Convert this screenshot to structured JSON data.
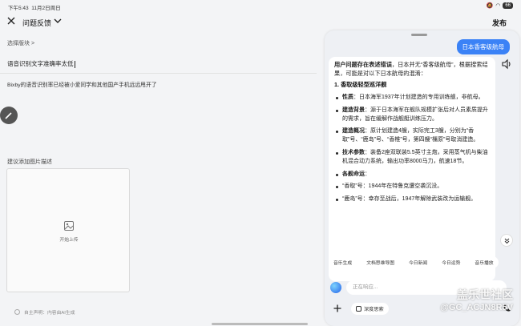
{
  "status": {
    "time": "下午5:43",
    "date": "11月2日周日",
    "battery": "66"
  },
  "header": {
    "title": "问题反馈",
    "publish": "发布"
  },
  "form": {
    "module_select": "选择版块 >",
    "title_value": "语音识别文字准确率太低",
    "description": "Bixby的语音识别率已经被小爱同学和其他国产手机远远甩开了",
    "image_label": "建议添加图片描述",
    "upload_text": "开始上传",
    "ai_disclaimer": "自主声明：内容由AI生成"
  },
  "chat": {
    "user_query": "日本香客级航母",
    "intro_bold": "用户问题存在表述错误",
    "intro_rest": "，日本并无“香客级航母”，根据搜索结果，可能是对以下日本航母的混淆：",
    "section_heading": "1. 香取级轻型巡洋舰",
    "bullets": [
      {
        "label": "性质",
        "text": "：日本海军1937年计划建造的专用训练舰，非航母。"
      },
      {
        "label": "建造背景",
        "text": "：源于日本海军在舰队规模扩张后对人员素质提升的需求，旨在缓解作战舰艇训练压力。"
      },
      {
        "label": "建造概况",
        "text": "：原计划建造4艘，实际完工3艘，分别为“香取”号、“鹿岛”号、“香椎”号，第四艘“橿原”号取消建造。"
      },
      {
        "label": "技术参数",
        "text": "：装备2座双联装5.5英寸主炮，采用蒸气机与柴油机混合动力系统，输出功率8000马力，航速18节。"
      },
      {
        "label": "各舰命运",
        "text": "："
      },
      {
        "label": "",
        "text": "“香取”号：1944年在特鲁克遭空袭沉没。"
      },
      {
        "label": "",
        "text": "“鹿岛”号：幸存至战后，1947年解除武装改为运输舰。"
      }
    ],
    "chips": [
      "音乐生成",
      "文档思维导图",
      "今日新闻",
      "今日运势",
      "音乐播放"
    ],
    "input_placeholder": "正在响应...",
    "deep_search": "深度思索"
  },
  "watermark": {
    "line1": "盖乐世社区",
    "line2": "@GC_ACJN8R5V"
  }
}
